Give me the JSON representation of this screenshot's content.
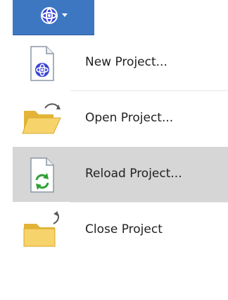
{
  "menu": {
    "items": [
      {
        "label": "New Project...",
        "icon": "new-project-icon"
      },
      {
        "label": "Open Project...",
        "icon": "open-folder-icon"
      },
      {
        "label": "Reload Project...",
        "icon": "reload-project-icon",
        "state": "hover"
      },
      {
        "label": "Close Project",
        "icon": "close-folder-icon"
      }
    ]
  },
  "colors": {
    "app_button_bg": "#3d77c2",
    "hover_bg": "#d6d6d6",
    "text": "#222222",
    "folder_fill": "#f3c84a",
    "logo_blue": "#3b45d6",
    "reload_green": "#2f9f34"
  }
}
